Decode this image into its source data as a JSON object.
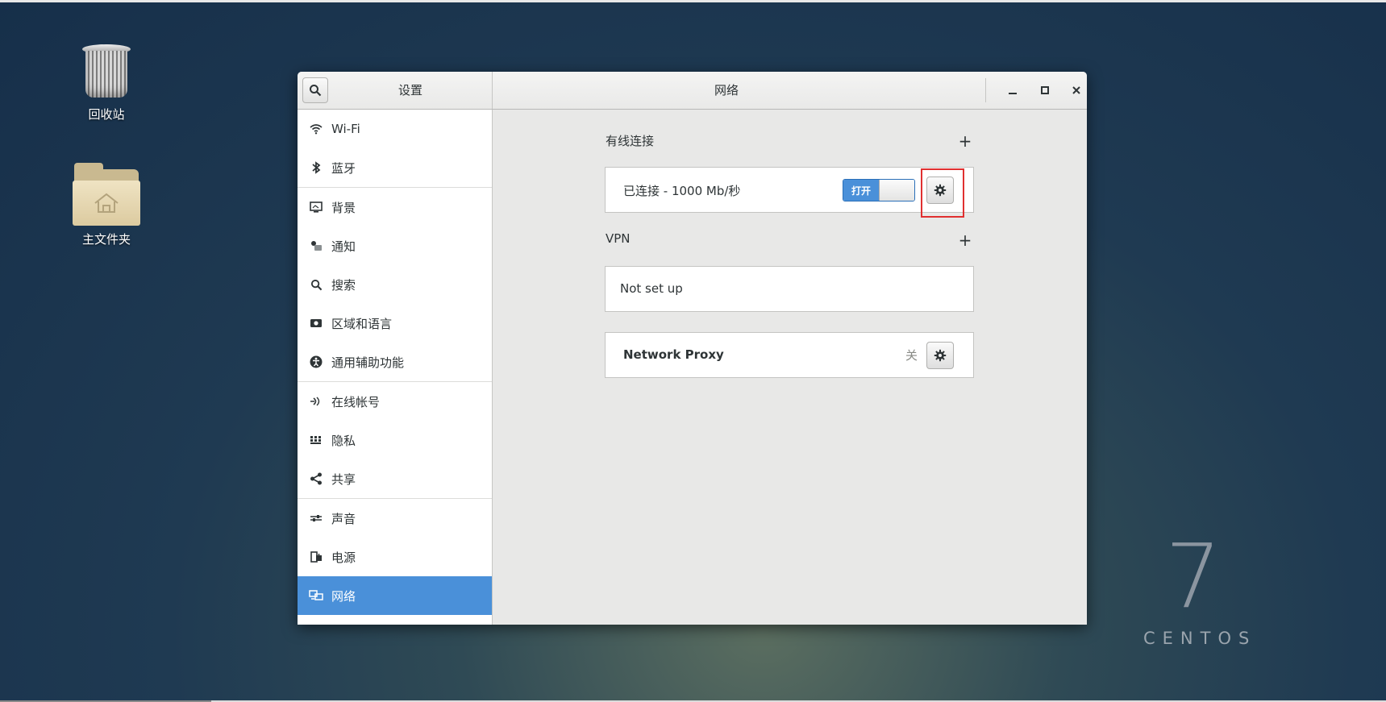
{
  "desktop": {
    "trash_label": "回收站",
    "home_label": "主文件夹",
    "brand_number": "7",
    "brand_text": "CENTOS"
  },
  "window": {
    "sidebar_title": "设置",
    "title": "网络",
    "controls": {
      "minimize": "–",
      "maximize": "□",
      "close": "✕"
    }
  },
  "sidebar": {
    "items": [
      {
        "label": "Wi-Fi",
        "icon": "wifi-icon"
      },
      {
        "label": "蓝牙",
        "icon": "bluetooth-icon"
      },
      {
        "label": "背景",
        "icon": "background-icon"
      },
      {
        "label": "通知",
        "icon": "notification-icon"
      },
      {
        "label": "搜索",
        "icon": "search-icon"
      },
      {
        "label": "区域和语言",
        "icon": "region-icon"
      },
      {
        "label": "通用辅助功能",
        "icon": "accessibility-icon"
      },
      {
        "label": "在线帐号",
        "icon": "online-accounts-icon"
      },
      {
        "label": "隐私",
        "icon": "privacy-icon"
      },
      {
        "label": "共享",
        "icon": "share-icon"
      },
      {
        "label": "声音",
        "icon": "sound-icon"
      },
      {
        "label": "电源",
        "icon": "power-icon"
      },
      {
        "label": "网络",
        "icon": "network-icon",
        "active": true
      }
    ]
  },
  "network": {
    "wired": {
      "section_label": "有线连接",
      "add_symbol": "+",
      "status": "已连接 - 1000 Mb/秒",
      "toggle_label": "打开",
      "toggle_on": true
    },
    "vpn": {
      "section_label": "VPN",
      "add_symbol": "+",
      "status": "Not set up"
    },
    "proxy": {
      "label": "Network Proxy",
      "status": "关"
    }
  },
  "colors": {
    "accent": "#4a90d9",
    "highlight": "#e03030"
  }
}
